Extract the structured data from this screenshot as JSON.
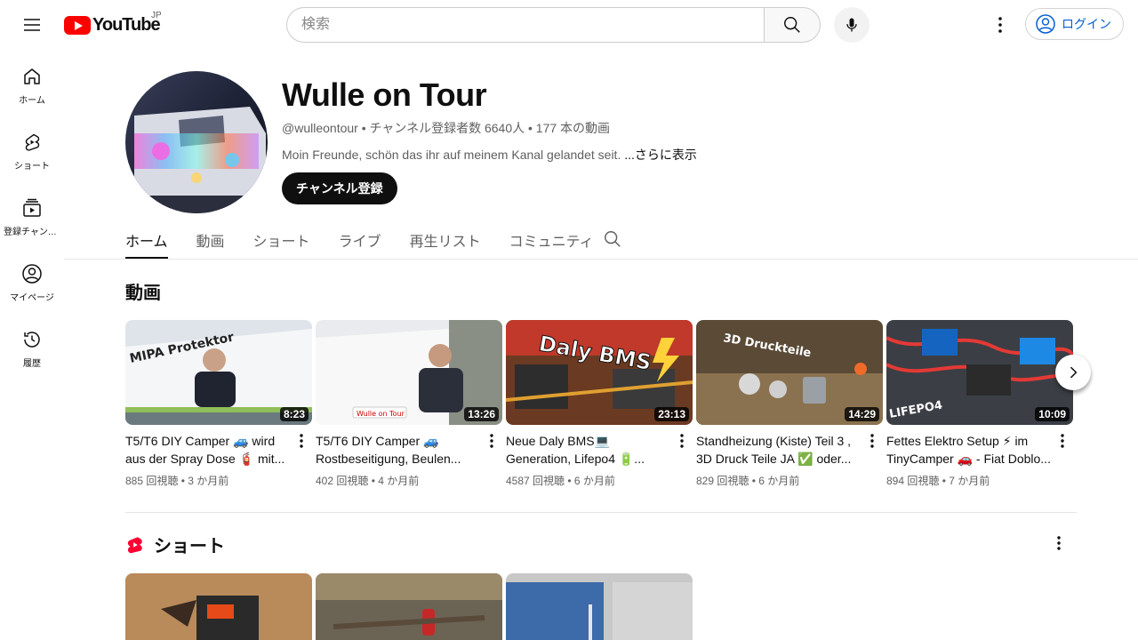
{
  "header": {
    "logo_text": "YouTube",
    "region": "JP",
    "search_placeholder": "検索",
    "login_label": "ログイン"
  },
  "sidebar": {
    "items": [
      {
        "label": "ホーム",
        "icon": "home-icon"
      },
      {
        "label": "ショート",
        "icon": "shorts-icon"
      },
      {
        "label": "登録チャンネル",
        "icon": "subscriptions-icon"
      },
      {
        "label": "マイページ",
        "icon": "you-icon"
      },
      {
        "label": "履歴",
        "icon": "history-icon"
      }
    ]
  },
  "channel": {
    "name": "Wulle on Tour",
    "meta": "@wulleontour • チャンネル登録者数 6640人 • 177 本の動画",
    "description": "Moin Freunde, schön das ihr auf meinem Kanal gelandet seit. ",
    "more_label": "...さらに表示",
    "subscribe_label": "チャンネル登録"
  },
  "tabs": [
    "ホーム",
    "動画",
    "ショート",
    "ライブ",
    "再生リスト",
    "コミュニティ"
  ],
  "videos_section": {
    "title": "動画",
    "videos": [
      {
        "title": "T5/T6 DIY Camper 🚙 wird aus der Spray Dose 🧯 mit...",
        "meta": "885 回視聴 • 3 か月前",
        "duration": "8:23",
        "thumb_text": "MIPA Protektor"
      },
      {
        "title": "T5/T6 DIY Camper 🚙 Rostbeseitigung, Beulen...",
        "meta": "402 回視聴 • 4 か月前",
        "duration": "13:26",
        "thumb_text": "Wulle on Tour"
      },
      {
        "title": "Neue Daly BMS💻 Generation, Lifepo4 🔋...",
        "meta": "4587 回視聴 • 6 か月前",
        "duration": "23:13",
        "thumb_text": "Daly BMS"
      },
      {
        "title": "Standheizung (Kiste) Teil 3 , 3D Druck Teile JA ✅ oder...",
        "meta": "829 回視聴 • 6 か月前",
        "duration": "14:29",
        "thumb_text": "3D Druckteile"
      },
      {
        "title": "Fettes Elektro Setup ⚡ im TinyCamper 🚗 - Fiat Doblo...",
        "meta": "894 回視聴 • 7 か月前",
        "duration": "10:09",
        "thumb_text": "LIFEPO4"
      }
    ]
  },
  "shorts_section": {
    "title": "ショート"
  },
  "colors": {
    "brand_red": "#ff0000",
    "link_blue": "#065fd4",
    "text_primary": "#0f0f0f",
    "text_secondary": "#606060"
  }
}
